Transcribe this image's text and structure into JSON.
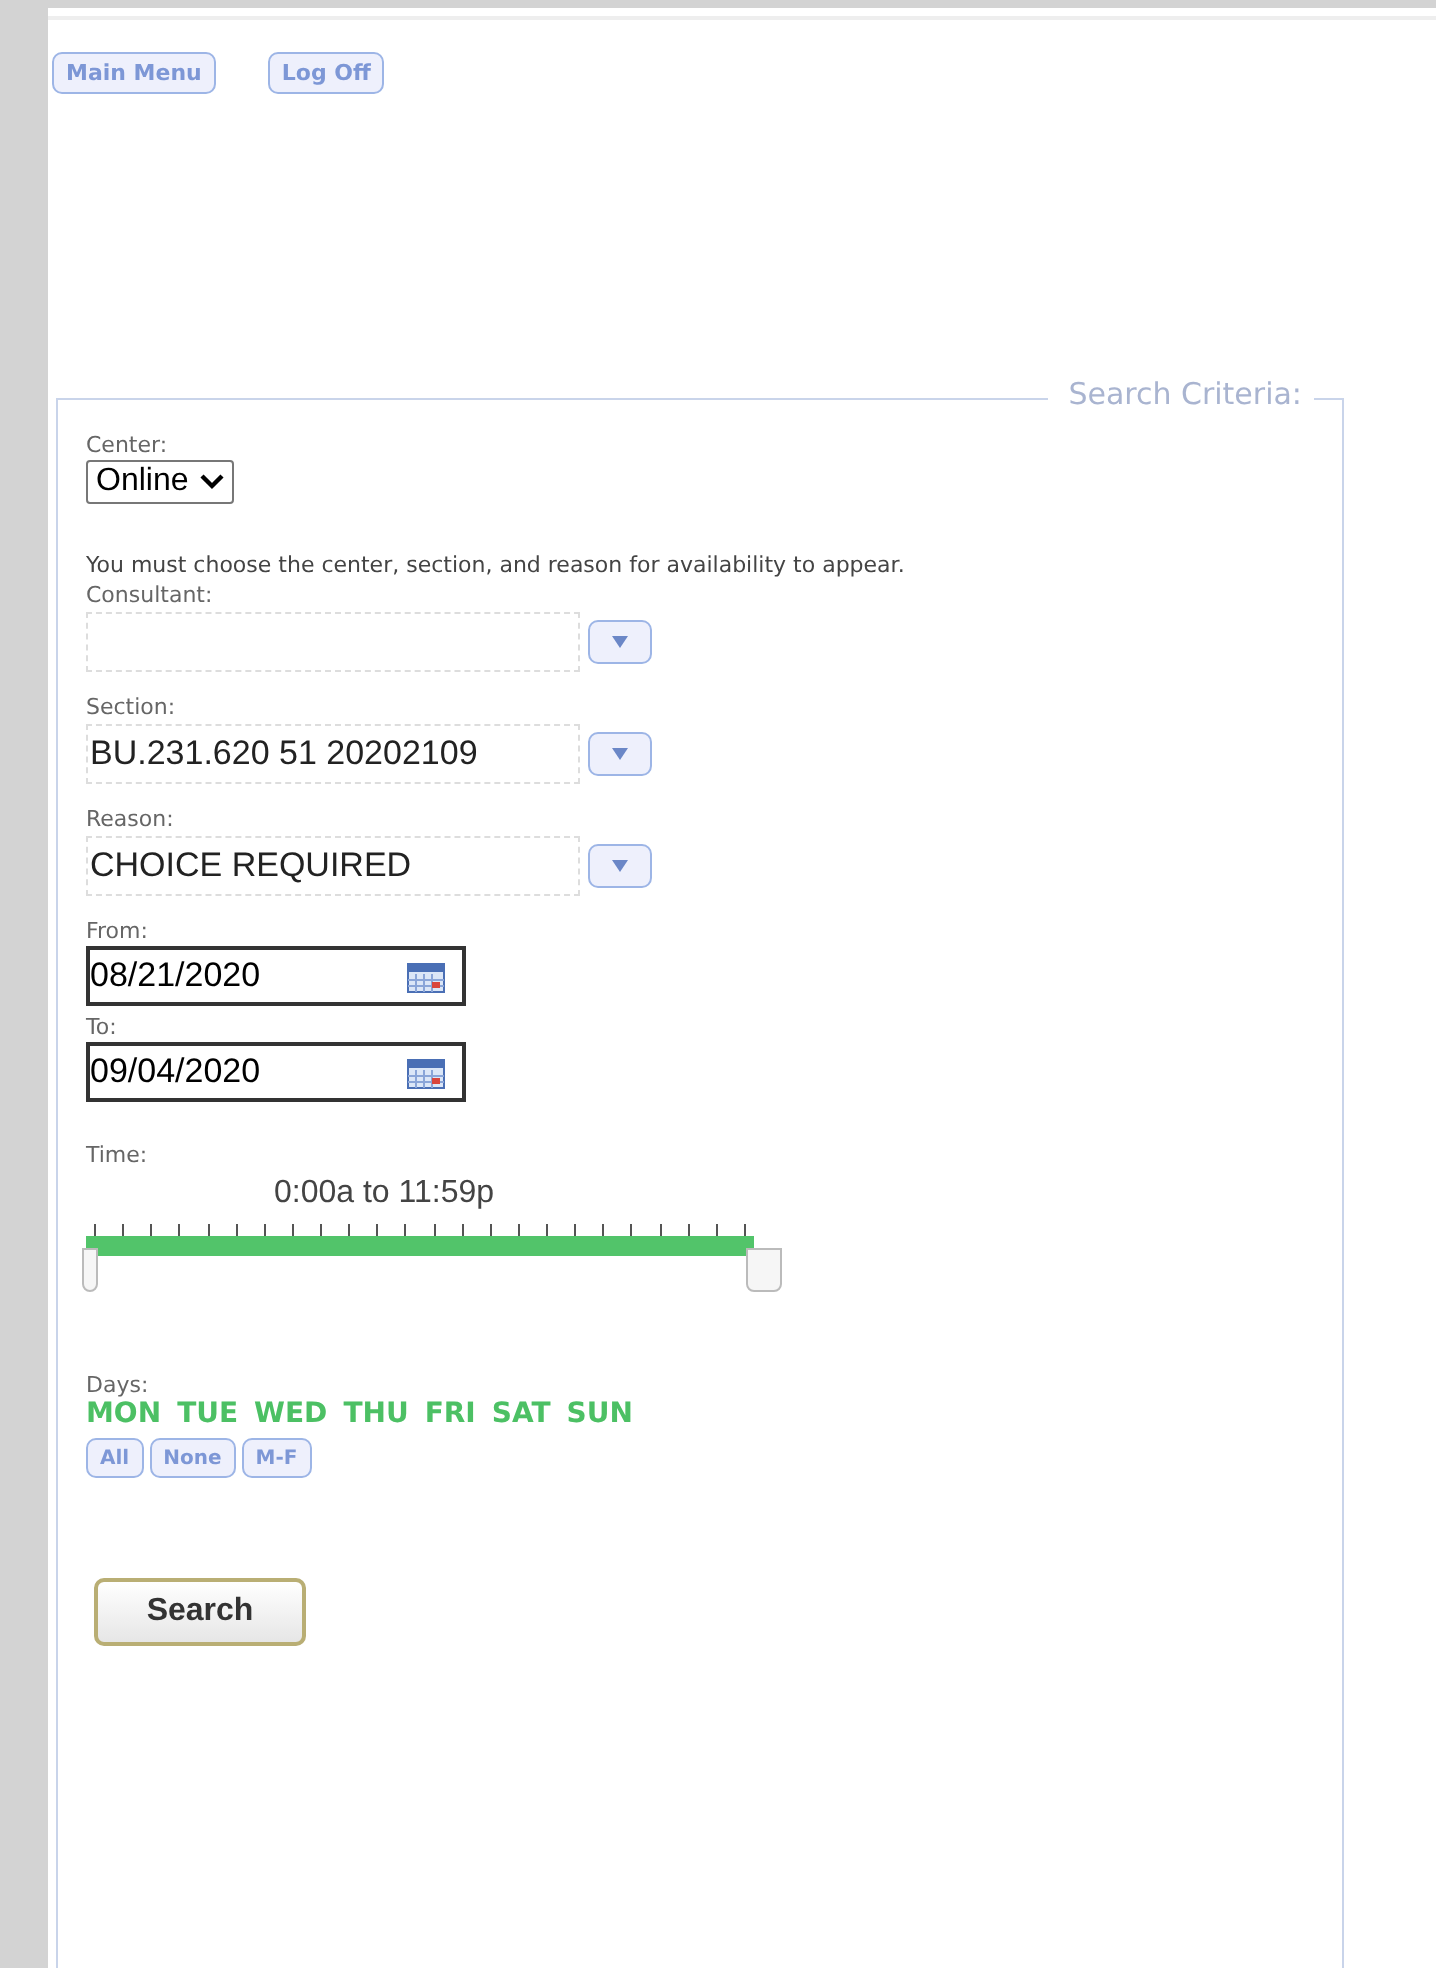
{
  "top_buttons": [
    "Main Menu",
    "Log Off"
  ],
  "search_criteria": {
    "legend": "Search Criteria:",
    "center": {
      "label": "Center:",
      "value": "Online"
    },
    "note": "You must choose the center, section, and reason for availability to appear.",
    "lookups": [
      {
        "label": "Consultant:"
      },
      {
        "label": "Section:",
        "value": "BU.231.620 51 20202109"
      },
      {
        "label": "Reason:",
        "value": "CHOICE REQUIRED"
      }
    ],
    "dates": [
      {
        "label": "From:",
        "value": "08/21/2020"
      },
      {
        "label": "To:",
        "value": "09/04/2020"
      }
    ],
    "time": {
      "label": "Time:",
      "reading": "0:00a to 11:59p",
      "level": 1
    },
    "days": {
      "label": "Days:",
      "items": [
        {
          "label": "MON",
          "selected": true
        },
        {
          "label": "TUE",
          "selected": true
        },
        {
          "label": "WED",
          "selected": true
        },
        {
          "label": "THU",
          "selected": true
        },
        {
          "label": "FRI",
          "selected": true
        },
        {
          "label": "SAT",
          "selected": true
        },
        {
          "label": "SUN",
          "selected": true
        }
      ],
      "buttons": [
        "All",
        "None",
        "M-F"
      ]
    },
    "search_button": "Search"
  }
}
